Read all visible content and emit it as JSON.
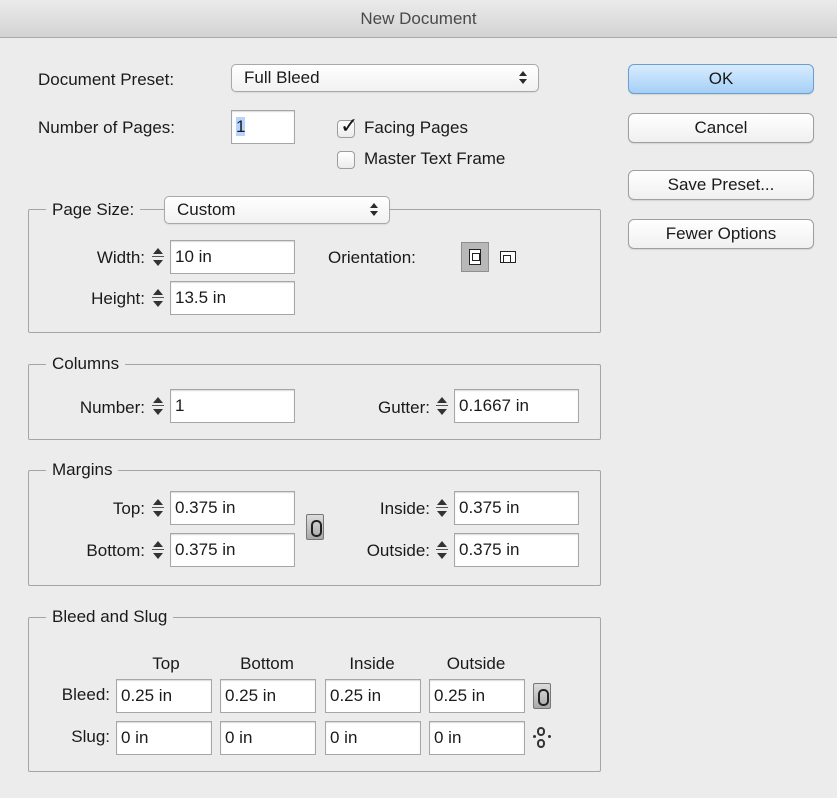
{
  "window": {
    "title": "New Document"
  },
  "preset": {
    "label": "Document Preset:",
    "value": "Full Bleed"
  },
  "pages": {
    "label": "Number of Pages:",
    "value": "1"
  },
  "options": {
    "facing_pages": {
      "label": "Facing Pages",
      "checked": true
    },
    "master_text_frame": {
      "label": "Master Text Frame",
      "checked": false
    }
  },
  "buttons": {
    "ok": "OK",
    "cancel": "Cancel",
    "save_preset": "Save Preset...",
    "fewer_options": "Fewer Options"
  },
  "page_size": {
    "label": "Page Size:",
    "value": "Custom",
    "width_label": "Width:",
    "width": "10 in",
    "height_label": "Height:",
    "height": "13.5 in",
    "orientation_label": "Orientation:",
    "orientation_selected": "portrait"
  },
  "columns": {
    "title": "Columns",
    "number_label": "Number:",
    "number": "1",
    "gutter_label": "Gutter:",
    "gutter": "0.1667 in"
  },
  "margins": {
    "title": "Margins",
    "top_label": "Top:",
    "top": "0.375 in",
    "bottom_label": "Bottom:",
    "bottom": "0.375 in",
    "inside_label": "Inside:",
    "inside": "0.375 in",
    "outside_label": "Outside:",
    "outside": "0.375 in"
  },
  "bleed_slug": {
    "title": "Bleed and Slug",
    "headers": [
      "Top",
      "Bottom",
      "Inside",
      "Outside"
    ],
    "bleed_label": "Bleed:",
    "bleed": [
      "0.25 in",
      "0.25 in",
      "0.25 in",
      "0.25 in"
    ],
    "slug_label": "Slug:",
    "slug": [
      "0 in",
      "0 in",
      "0 in",
      "0 in"
    ]
  }
}
